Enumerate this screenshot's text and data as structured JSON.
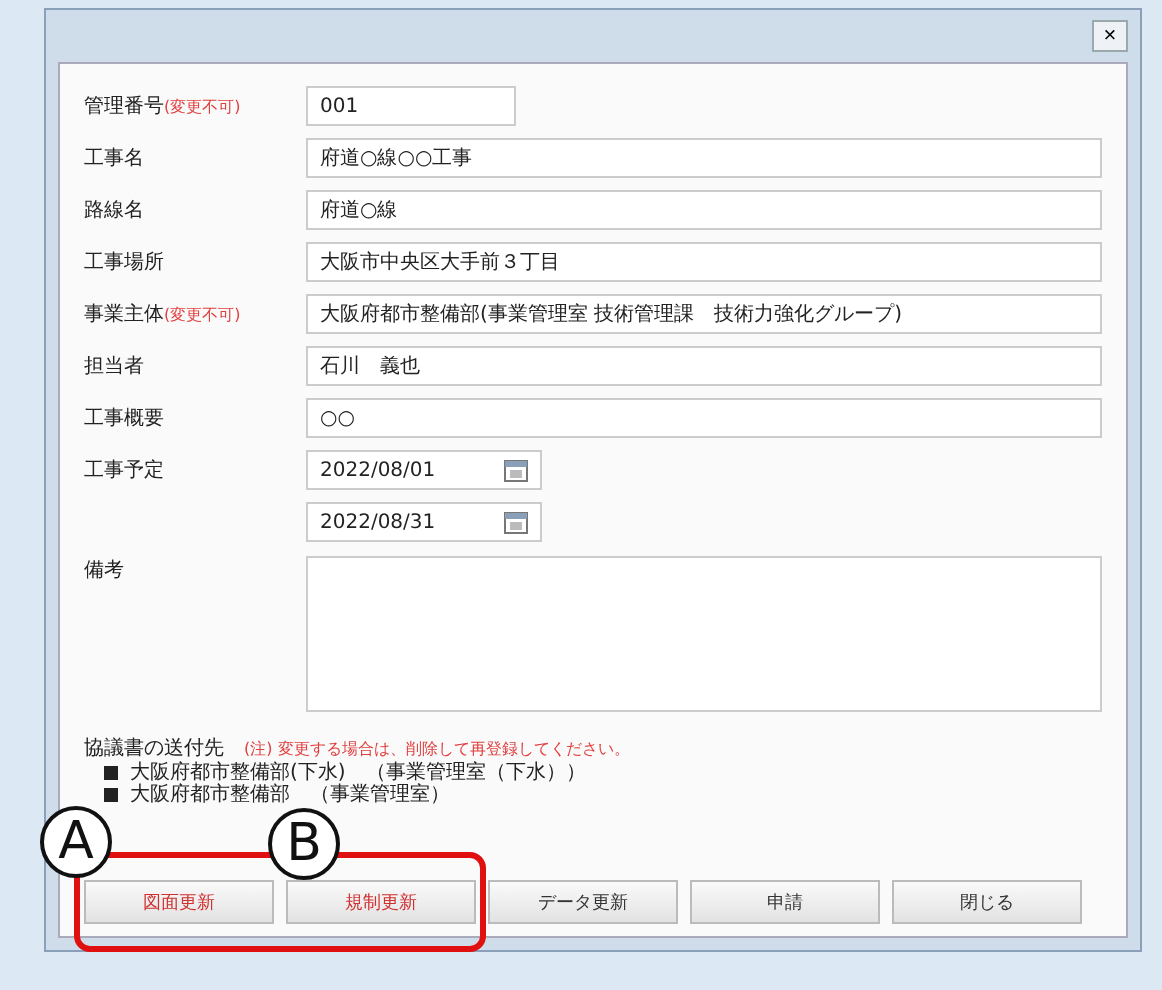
{
  "window": {
    "close": "×"
  },
  "fields": [
    {
      "label": "管理番号",
      "note": "(変更不可)",
      "kind": "short",
      "value": "001"
    },
    {
      "label": "工事名",
      "kind": "text",
      "value": "府道○線○○工事"
    },
    {
      "label": "路線名",
      "kind": "text",
      "value": "府道○線"
    },
    {
      "label": "工事場所",
      "kind": "text",
      "value": "大阪市中央区大手前３丁目"
    },
    {
      "label": "事業主体",
      "note": "(変更不可)",
      "kind": "text",
      "value": "大阪府都市整備部(事業管理室 技術管理課　技術力強化グループ)"
    },
    {
      "label": "担当者",
      "kind": "text",
      "value": "石川　義也"
    },
    {
      "label": "工事概要",
      "kind": "text",
      "value": "○○"
    },
    {
      "label": "工事予定",
      "kind": "date",
      "value": "2022/08/01"
    },
    {
      "kind": "date",
      "value": "2022/08/31"
    },
    {
      "label": "備考",
      "kind": "area"
    }
  ],
  "recipients": {
    "label": "協議書の送付先",
    "note": "(注) 変更する場合は、削除して再登録してください。",
    "items": [
      "大阪府都市整備部(下水)　（事業管理室（下水））",
      "大阪府都市整備部　（事業管理室）"
    ]
  },
  "buttons": [
    {
      "label": "図面更新",
      "highlighted": true
    },
    {
      "label": "規制更新",
      "highlighted": true
    },
    {
      "label": "データ更新",
      "highlighted": false
    },
    {
      "label": "申請",
      "highlighted": false
    },
    {
      "label": "閉じる",
      "highlighted": false
    }
  ],
  "callouts": [
    {
      "label": "A"
    },
    {
      "label": "B"
    }
  ]
}
